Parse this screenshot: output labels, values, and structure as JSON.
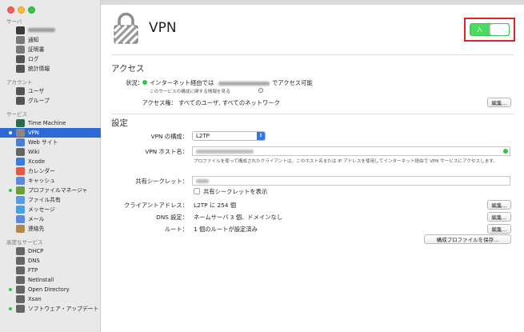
{
  "sidebar": {
    "sections": [
      {
        "header": "サーバ",
        "items": [
          {
            "label": "",
            "icon": "server-icon",
            "color": "#3a3a3a",
            "blurred": true
          },
          {
            "label": "通知",
            "icon": "bell-icon",
            "color": "#7a7a7a"
          },
          {
            "label": "証明書",
            "icon": "certificate-icon",
            "color": "#7a7a7a"
          },
          {
            "label": "ログ",
            "icon": "log-icon",
            "color": "#555555"
          },
          {
            "label": "統計情報",
            "icon": "stats-icon",
            "color": "#555555"
          }
        ]
      },
      {
        "header": "アカウント",
        "items": [
          {
            "label": "ユーザ",
            "icon": "user-icon",
            "color": "#555555"
          },
          {
            "label": "グループ",
            "icon": "group-icon",
            "color": "#555555"
          }
        ]
      },
      {
        "header": "サービス",
        "items": [
          {
            "label": "Time Machine",
            "icon": "time-machine-icon",
            "color": "#2c6b4e"
          },
          {
            "label": "VPN",
            "icon": "vpn-lock-icon",
            "color": "#888888",
            "selected": true,
            "running": true
          },
          {
            "label": "Web サイト",
            "icon": "globe-icon",
            "color": "#4a7fd4"
          },
          {
            "label": "Wiki",
            "icon": "wiki-icon",
            "color": "#666666"
          },
          {
            "label": "Xcode",
            "icon": "xcode-icon",
            "color": "#3b7dd8"
          },
          {
            "label": "カレンダー",
            "icon": "calendar-icon",
            "color": "#e25a4c"
          },
          {
            "label": "キャッシュ",
            "icon": "cache-icon",
            "color": "#5c8ad8"
          },
          {
            "label": "プロファイルマネージャ",
            "icon": "profile-manager-icon",
            "color": "#6c9c3c",
            "running": true
          },
          {
            "label": "ファイル共有",
            "icon": "folder-icon",
            "color": "#5c9ae0"
          },
          {
            "label": "メッセージ",
            "icon": "messages-icon",
            "color": "#49a0e5"
          },
          {
            "label": "メール",
            "icon": "mail-icon",
            "color": "#5c8ad8"
          },
          {
            "label": "連絡先",
            "icon": "contacts-icon",
            "color": "#b08850"
          }
        ]
      },
      {
        "header": "高度なサービス",
        "items": [
          {
            "label": "DHCP",
            "icon": "dhcp-icon",
            "color": "#666666"
          },
          {
            "label": "DNS",
            "icon": "dns-icon",
            "color": "#666666"
          },
          {
            "label": "FTP",
            "icon": "ftp-icon",
            "color": "#666666"
          },
          {
            "label": "NetInstall",
            "icon": "netinstall-icon",
            "color": "#666666"
          },
          {
            "label": "Open Directory",
            "icon": "open-directory-icon",
            "color": "#666666",
            "running": true
          },
          {
            "label": "Xsan",
            "icon": "xsan-icon",
            "color": "#666666"
          },
          {
            "label": "ソフトウェア・アップデート",
            "icon": "software-update-icon",
            "color": "#666666",
            "running": true
          }
        ]
      }
    ]
  },
  "main": {
    "title": "VPN",
    "toggle": {
      "label": "入",
      "state": "on",
      "on_color": "#4cd964"
    },
    "access": {
      "heading": "アクセス",
      "status_label": "状況：",
      "status_prefix": "インターネット経由では",
      "status_suffix": "でアクセス可能",
      "status_note": "このサービスの構成に関する情報を見る",
      "access_rights_label": "アクセス権：",
      "access_rights_value": "すべてのユーザ, すべてのネットワーク",
      "edit_button": "編集..."
    },
    "settings": {
      "heading": "設定",
      "vpn_config_label": "VPN の構成：",
      "vpn_config_value": "L2TP",
      "vpn_host_label": "VPN ホスト名：",
      "vpn_host_note": "プロファイルを使って構成されたクライアントは、このホスト名または IP アドレスを使用してインターネット経由で VPN サービスにアクセスします。",
      "shared_secret_label": "共有シークレット：",
      "show_secret_label": "共有シークレットを表示",
      "client_address_label": "クライアントアドレス：",
      "client_address_value": "L2TP に 254 個",
      "dns_label": "DNS 設定：",
      "dns_value": "ネームサーバ 3 個、ドメインなし",
      "routes_label": "ルート：",
      "routes_value": "1 個のルートが設定済み",
      "edit_button": "編集...",
      "save_profile_button": "構成プロファイルを保存..."
    }
  }
}
